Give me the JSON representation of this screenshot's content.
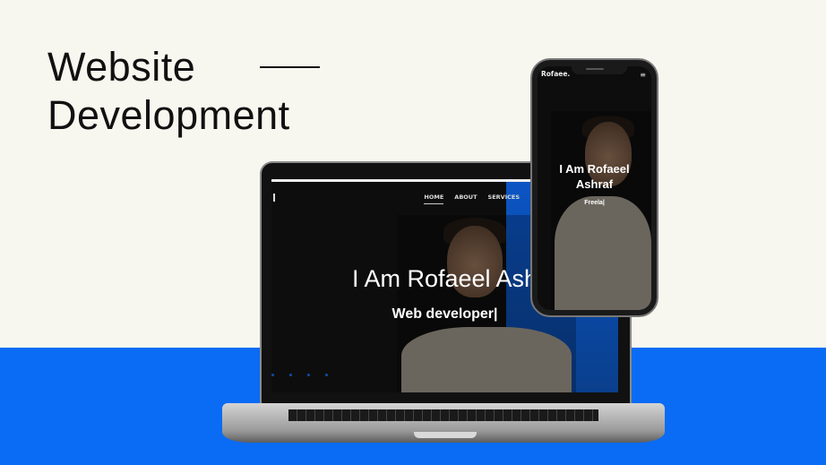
{
  "heading": {
    "line1": "Website",
    "line2": "Development"
  },
  "laptop": {
    "nav": [
      "HOME",
      "ABOUT",
      "SERVICES"
    ],
    "hero_title": "I Am Rofaeel Ash",
    "hero_subtitle": "Web developer|"
  },
  "phone": {
    "brand": "Rofaee.",
    "menu_icon": "≡",
    "hero_title_line1": "I Am Rofaeel",
    "hero_title_line2": "Ashraf",
    "hero_subtitle": "Freela|"
  },
  "colors": {
    "background": "#f8f7ef",
    "accent": "#0a6cf4"
  }
}
